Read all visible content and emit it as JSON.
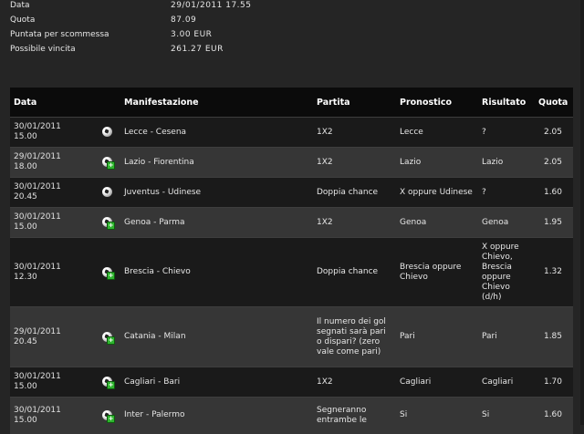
{
  "summary": {
    "data_label": "Data",
    "data_value": "29/01/2011 17.55",
    "quota_label": "Quota",
    "quota_value": "87.09",
    "puntata_label": "Puntata per scommessa",
    "puntata_value": "3.00 EUR",
    "vincita_label": "Possibile vincita",
    "vincita_value": "261.27 EUR"
  },
  "table": {
    "headers": {
      "data": "Data",
      "manifestazione": "Manifestazione",
      "partita": "Partita",
      "pronostico": "Pronostico",
      "risultato": "Risultato",
      "quota": "Quota"
    },
    "rows": [
      {
        "date": "30/01/2011",
        "time": "15.00",
        "icon": "soccer-ball-icon",
        "manif": "Lecce - Cesena",
        "partita": "1X2",
        "pron": "Lecce",
        "ris": "?",
        "quota": "2.05"
      },
      {
        "date": "29/01/2011",
        "time": "18.00",
        "icon": "soccer-ball-plus-icon",
        "manif": "Lazio - Fiorentina",
        "partita": "1X2",
        "pron": "Lazio",
        "ris": "Lazio",
        "quota": "2.05"
      },
      {
        "date": "30/01/2011",
        "time": "20.45",
        "icon": "soccer-ball-icon",
        "manif": "Juventus - Udinese",
        "partita": "Doppia chance",
        "pron": "X oppure Udinese",
        "ris": "?",
        "quota": "1.60"
      },
      {
        "date": "30/01/2011",
        "time": "15.00",
        "icon": "soccer-ball-plus-icon",
        "manif": "Genoa - Parma",
        "partita": "1X2",
        "pron": "Genoa",
        "ris": "Genoa",
        "quota": "1.95"
      },
      {
        "date": "30/01/2011",
        "time": "12.30",
        "icon": "soccer-ball-plus-icon",
        "manif": "Brescia - Chievo",
        "partita": "Doppia chance",
        "pron": "Brescia oppure Chievo",
        "ris": "X oppure Chievo, Brescia oppure Chievo (d/h)",
        "quota": "1.32"
      },
      {
        "date": "29/01/2011",
        "time": "20.45",
        "icon": "soccer-ball-plus-icon",
        "manif": "Catania - Milan",
        "partita": "Il numero dei gol segnati sarà pari o dispari? (zero vale come pari)",
        "pron": "Pari",
        "ris": "Pari",
        "quota": "1.85"
      },
      {
        "date": "30/01/2011",
        "time": "15.00",
        "icon": "soccer-ball-plus-icon",
        "manif": "Cagliari - Bari",
        "partita": "1X2",
        "pron": "Cagliari",
        "ris": "Cagliari",
        "quota": "1.70"
      },
      {
        "date": "30/01/2011",
        "time": "15.00",
        "icon": "soccer-ball-plus-icon",
        "manif": "Inter - Palermo",
        "partita": "Segneranno entrambe le",
        "pron": "Si",
        "ris": "Si",
        "quota": "1.60"
      }
    ]
  }
}
